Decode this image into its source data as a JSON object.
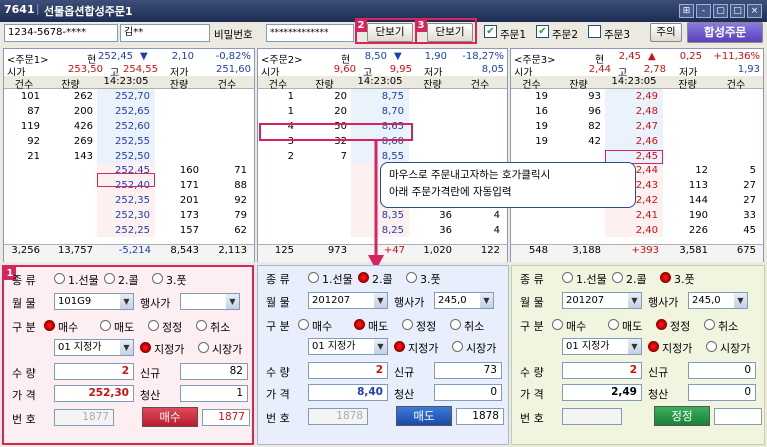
{
  "window": {
    "id": "7641",
    "title": "선물옵션합성주문1",
    "controls": [
      "⊞",
      "-",
      "▢",
      "□",
      "×"
    ]
  },
  "toolbar": {
    "account": "1234-5678-****",
    "name": "김**",
    "password_label": "비밀번호",
    "password": "*************",
    "btn2": "단보기",
    "btn3": "단보기",
    "badge2": "2",
    "badge3": "3",
    "cb1": "주문1",
    "cb2": "주문2",
    "cb3": "주문3",
    "caution": "주의",
    "combined": "합성주문"
  },
  "panels": [
    {
      "label": "<주문1>",
      "cur_label": "현",
      "cur": "252,45",
      "arrow": "▼",
      "chg": "2,10",
      "pct": "-0,82%",
      "open_l": "시가",
      "open": "253,50",
      "high_l": "고",
      "high": "254,55",
      "low_l": "저가",
      "low": "251,60",
      "h": [
        "건수",
        "잔량",
        "14:23:05",
        "잔량",
        "건수"
      ],
      "asks": [
        [
          "101",
          "262",
          "252,70"
        ],
        [
          "87",
          "200",
          "252,65"
        ],
        [
          "119",
          "426",
          "252,60"
        ],
        [
          "92",
          "269",
          "252,55"
        ],
        [
          "21",
          "143",
          "252,50"
        ]
      ],
      "bids": [
        [
          "252,45",
          "160",
          "71"
        ],
        [
          "252,40",
          "171",
          "88"
        ],
        [
          "252,35",
          "201",
          "92"
        ],
        [
          "252,30",
          "173",
          "79"
        ],
        [
          "252,25",
          "157",
          "62"
        ]
      ],
      "tot": [
        "3,256",
        "13,757",
        "-5,214",
        "8,543",
        "2,113"
      ]
    },
    {
      "label": "<주문2>",
      "cur_label": "현",
      "cur": "8,50",
      "arrow": "▼",
      "chg": "1,90",
      "pct": "-18,27%",
      "open_l": "시가",
      "open": "9,60",
      "high_l": "고",
      "high": "9,95",
      "low_l": "저가",
      "low": "8,05",
      "h": [
        "건수",
        "잔량",
        "14:23:05",
        "잔량",
        "건수"
      ],
      "asks": [
        [
          "1",
          "20",
          "8,75"
        ],
        [
          "1",
          "20",
          "8,70"
        ],
        [
          "4",
          "50",
          "8,65"
        ],
        [
          "3",
          "32",
          "8,60"
        ],
        [
          "2",
          "7",
          "8,55"
        ]
      ],
      "bids": [
        [
          "8,50",
          "",
          ""
        ],
        [
          "8,45",
          "",
          ""
        ],
        [
          "8,40",
          "",
          ""
        ],
        [
          "8,35",
          "36",
          "4"
        ],
        [
          "8,25",
          "36",
          "4"
        ]
      ],
      "tot": [
        "125",
        "973",
        "+47",
        "1,020",
        "122"
      ]
    },
    {
      "label": "<주문3>",
      "cur_label": "현",
      "cur": "2,45",
      "arrow": "▲",
      "chg": "0,25",
      "pct": "+11,36%",
      "open_l": "시가",
      "open": "2,44",
      "high_l": "고",
      "high": "2,78",
      "low_l": "저가",
      "low": "1,93",
      "h": [
        "건수",
        "잔량",
        "14:23:05",
        "잔량",
        "건수"
      ],
      "asks": [
        [
          "19",
          "93",
          "2,49"
        ],
        [
          "16",
          "96",
          "2,48"
        ],
        [
          "19",
          "82",
          "2,47"
        ],
        [
          "19",
          "42",
          "2,46"
        ],
        [
          "",
          "",
          "2,45"
        ]
      ],
      "bids": [
        [
          "2,44",
          "12",
          "5"
        ],
        [
          "2,43",
          "113",
          "27"
        ],
        [
          "2,42",
          "144",
          "27"
        ],
        [
          "2,41",
          "190",
          "33"
        ],
        [
          "2,40",
          "226",
          "45"
        ]
      ],
      "tot": [
        "548",
        "3,188",
        "+393",
        "3,581",
        "675"
      ]
    }
  ],
  "tooltip": {
    "line1": "마우스로 주문내고자하는 호가클릭시",
    "line2": "아래 주문가격란에 자동입력"
  },
  "orders": [
    {
      "badge": "1",
      "kind_l": "종    류",
      "kind": [
        "1.선물",
        "2.콜",
        "3.풋"
      ],
      "month_l": "월    물",
      "month": "101G9",
      "strike_l": "행사가",
      "strike": "",
      "div_l": "구    분",
      "div": [
        "매수",
        "매도",
        "정정",
        "취소"
      ],
      "ptype": "01 지정가",
      "pt": [
        "지정가",
        "시장가"
      ],
      "qty_l": "수    량",
      "qty": "2",
      "new_l": "신규",
      "new": "82",
      "price_l": "가    격",
      "price": "252,30",
      "settle_l": "청산",
      "settle": "1",
      "no_l": "번    호",
      "no": "1877",
      "action": "매수",
      "ord": "1877"
    },
    {
      "kind_l": "종    류",
      "kind": [
        "1.선물",
        "2.콜",
        "3.풋"
      ],
      "month_l": "월    물",
      "month": "201207",
      "strike_l": "행사가",
      "strike": "245,0",
      "div_l": "구    분",
      "div": [
        "매수",
        "매도",
        "정정",
        "취소"
      ],
      "ptype": "01 지정가",
      "pt": [
        "지정가",
        "시장가"
      ],
      "qty_l": "수    량",
      "qty": "2",
      "new_l": "신규",
      "new": "73",
      "price_l": "가    격",
      "price": "8,40",
      "settle_l": "청산",
      "settle": "0",
      "no_l": "번    호",
      "no": "1878",
      "action": "매도",
      "ord": "1878"
    },
    {
      "kind_l": "종    류",
      "kind": [
        "1.선물",
        "2.콜",
        "3.풋"
      ],
      "month_l": "월    물",
      "month": "201207",
      "strike_l": "행사가",
      "strike": "245,0",
      "div_l": "구    분",
      "div": [
        "매수",
        "매도",
        "정정",
        "취소"
      ],
      "ptype": "01 지정가",
      "pt": [
        "지정가",
        "시장가"
      ],
      "qty_l": "수    량",
      "qty": "2",
      "new_l": "신규",
      "new": "0",
      "price_l": "가    격",
      "price": "2,49",
      "settle_l": "청산",
      "settle": "0",
      "no_l": "번    호",
      "no": "",
      "action": "정정",
      "ord": ""
    }
  ]
}
